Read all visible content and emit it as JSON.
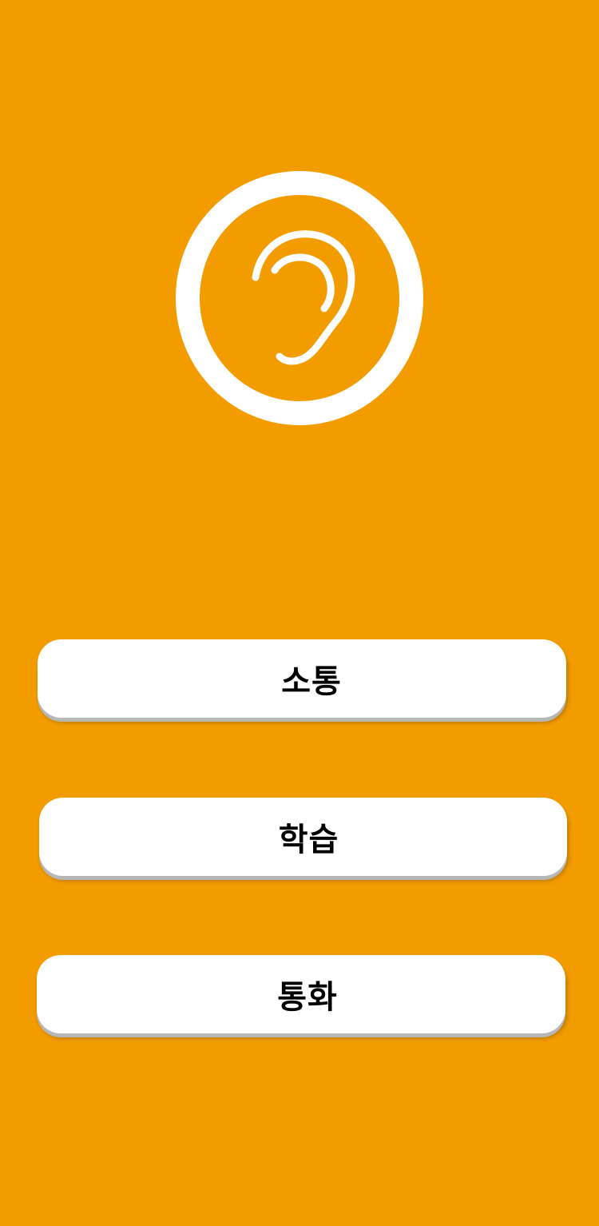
{
  "logo": {
    "icon": "ear-icon",
    "ring_color": "#FFFFFF",
    "fill_color": "#F39C00"
  },
  "menu": {
    "items": [
      {
        "label": "소통"
      },
      {
        "label": "학습"
      },
      {
        "label": "통화"
      }
    ]
  },
  "colors": {
    "background": "#F39C00",
    "button": "#FFFFFF",
    "button_text": "#000000"
  }
}
